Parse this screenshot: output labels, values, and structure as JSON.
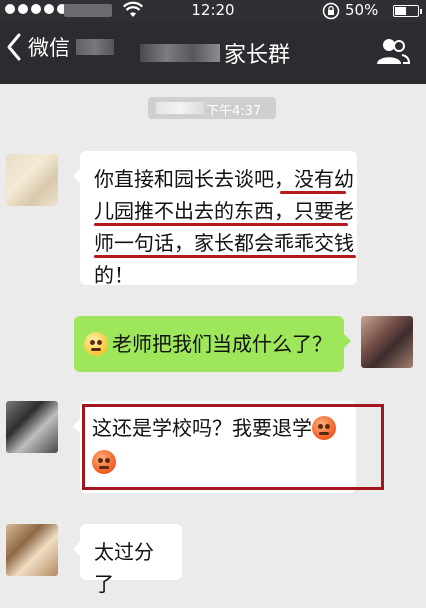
{
  "status_bar": {
    "time": "12:20",
    "battery_percent": "50%"
  },
  "nav": {
    "back_label": "微信",
    "title": "家长群"
  },
  "chat": {
    "timestamp": "下午4:37",
    "messages": [
      {
        "side": "left",
        "lines": [
          "你直接和园长去谈吧，没有幼",
          "儿园推不出去的东西，只要老",
          "师一句话，家长都会乖乖交钱",
          "的！"
        ]
      },
      {
        "side": "right",
        "text": "老师把我们当成什么了？"
      },
      {
        "side": "left",
        "text": "这还是学校吗？我要退学"
      },
      {
        "side": "left",
        "text": "太过分了"
      }
    ]
  },
  "colors": {
    "nav_bg": "#2b2c30",
    "chat_bg": "#ebebeb",
    "sent_bubble": "#9fe75a",
    "received_bubble": "#ffffff",
    "highlight_red": "#a4161c"
  },
  "icons": [
    "signal-dots-icon",
    "wifi-icon",
    "lock-rotation-icon",
    "battery-icon",
    "back-chevron-icon",
    "group-members-icon",
    "confused-face-emoji",
    "angry-face-emoji"
  ]
}
